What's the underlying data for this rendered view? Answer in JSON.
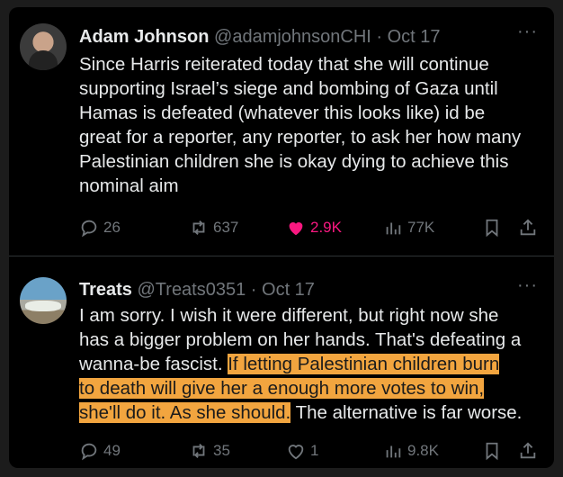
{
  "tweets": [
    {
      "name": "Adam Johnson",
      "meta": "@adamjohnsonCHI · Oct 17",
      "more": "···",
      "lines": [
        "Since Harris reiterated today that she will continue",
        "supporting Israel’s siege and bombing of Gaza until",
        "Hamas is defeated (whatever this looks like) id be",
        "great for a reporter, any reporter, to ask her how many",
        "Palestinian children she is okay dying to achieve this",
        "nominal aim"
      ],
      "stats": {
        "replies": "26",
        "reposts": "637",
        "likes": "2.9K",
        "views": "77K"
      }
    },
    {
      "name": "Treats",
      "meta": "@Treats0351 · Oct 17",
      "more": "···",
      "lines": [
        "I am sorry. I wish it were different, but right now she",
        "has a bigger problem on her hands. That's defeating a"
      ],
      "line3_pre": "wanna-be fascist. ",
      "line3_hl": "If letting Palestinian children burn",
      "line4_hl": "to death will give her a enough more votes to win,",
      "line5_hl": "she'll do it. As she should.",
      "line5_post": " The alternative is far worse.",
      "stats": {
        "replies": "49",
        "reposts": "35",
        "likes": "1",
        "views": "9.8K"
      }
    }
  ],
  "colors": {
    "accent_like": "#f91880",
    "highlight": "#f2a53f"
  }
}
